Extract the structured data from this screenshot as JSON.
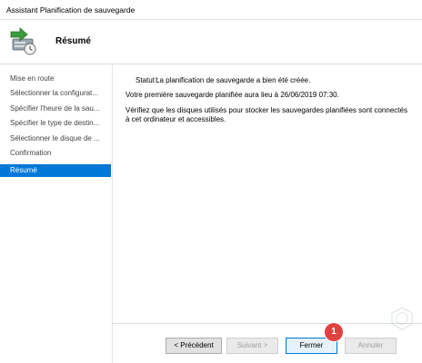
{
  "window": {
    "title": "Assistant Planification de sauvegarde"
  },
  "header": {
    "page_title": "Résumé",
    "icon": "backup-clock-icon"
  },
  "sidebar": {
    "steps": [
      {
        "label": "Mise en route"
      },
      {
        "label": "Sélectionner la configurat..."
      },
      {
        "label": "Spécifier l'heure de la sau..."
      },
      {
        "label": "Spécifier le type de destin..."
      },
      {
        "label": "Sélectionner le disque de ..."
      },
      {
        "label": "Confirmation"
      },
      {
        "label": "Résumé"
      }
    ],
    "active_index": 6,
    "active_color": "#0078d7"
  },
  "content": {
    "status_label": "Statut :",
    "status_text": "La planification de sauvegarde a bien été créée.",
    "next_backup": "Votre première sauvegarde planifiée aura lieu à 26/06/2019 07:30.",
    "verify_text": "Vérifiez que les disques utilisés pour stocker les sauvegardes planifiées sont connectés à cet ordinateur et accessibles."
  },
  "buttons": {
    "previous": "< Précédent",
    "next": "Suivant >",
    "close": "Fermer",
    "cancel": "Annuler"
  },
  "annotation": {
    "badge": "1",
    "color": "#e0433f"
  }
}
